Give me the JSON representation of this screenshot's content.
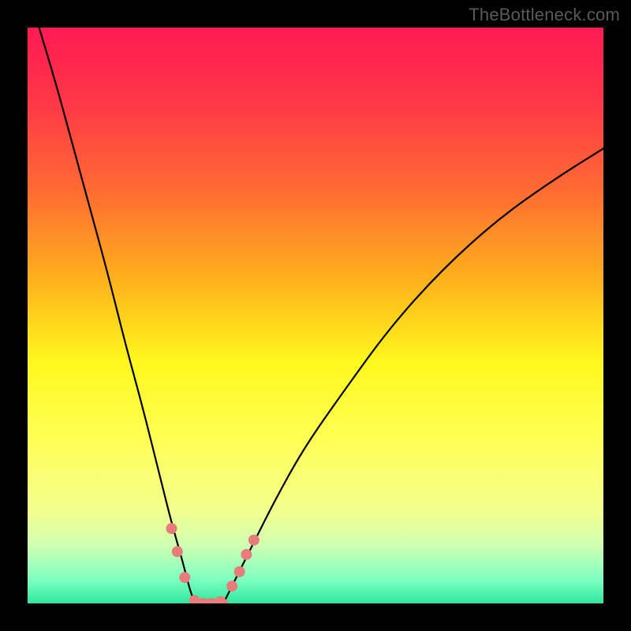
{
  "watermark": {
    "text": "TheBottleneck.com"
  },
  "chart_data": {
    "type": "line",
    "title": "",
    "xlabel": "",
    "ylabel": "",
    "xlim": [
      0,
      100
    ],
    "ylim": [
      0,
      100
    ],
    "gradient_stops": [
      {
        "pct": 0,
        "color": "#ff1a52"
      },
      {
        "pct": 12,
        "color": "#ff3448"
      },
      {
        "pct": 28,
        "color": "#ff6a33"
      },
      {
        "pct": 44,
        "color": "#ffb21c"
      },
      {
        "pct": 58,
        "color": "#fff81d"
      },
      {
        "pct": 72,
        "color": "#ffff57"
      },
      {
        "pct": 84,
        "color": "#f2ff8e"
      },
      {
        "pct": 90,
        "color": "#cfffb3"
      },
      {
        "pct": 96,
        "color": "#7bffc0"
      },
      {
        "pct": 100,
        "color": "#2fe7a0"
      }
    ],
    "series": [
      {
        "name": "left-curve",
        "x": [
          2,
          5,
          8,
          11,
          14,
          17,
          20,
          23,
          25,
          27,
          28,
          29
        ],
        "y": [
          100,
          90,
          79,
          68,
          57,
          45,
          34,
          22,
          14,
          7,
          3,
          0
        ]
      },
      {
        "name": "right-curve",
        "x": [
          34,
          36,
          39,
          43,
          48,
          55,
          63,
          72,
          82,
          92,
          100
        ],
        "y": [
          0,
          4,
          10,
          18,
          27,
          37,
          48,
          58,
          67,
          74,
          79
        ]
      },
      {
        "name": "trough-flat",
        "x": [
          29,
          30,
          31,
          32,
          33,
          34
        ],
        "y": [
          0,
          0,
          0,
          0,
          0,
          0
        ]
      }
    ],
    "markers": [
      {
        "x": 25.0,
        "y": 13.0
      },
      {
        "x": 26.0,
        "y": 9.0
      },
      {
        "x": 27.3,
        "y": 4.5
      },
      {
        "x": 29.0,
        "y": 0.5
      },
      {
        "x": 30.5,
        "y": 0.0
      },
      {
        "x": 32.0,
        "y": 0.0
      },
      {
        "x": 33.5,
        "y": 0.3
      },
      {
        "x": 35.5,
        "y": 3.0
      },
      {
        "x": 36.8,
        "y": 5.5
      },
      {
        "x": 38.0,
        "y": 8.5
      },
      {
        "x": 39.3,
        "y": 11.0
      }
    ],
    "marker_color": "#e77d7b",
    "curve_color": "#000000"
  }
}
